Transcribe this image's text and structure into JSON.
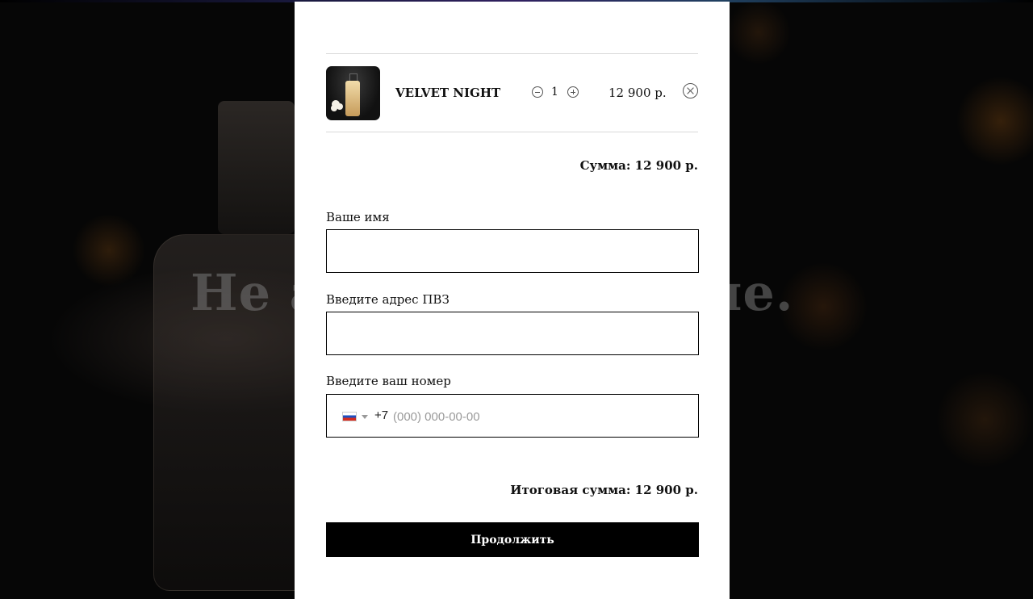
{
  "background": {
    "headline_visible_left": "Не а",
    "headline_visible_right": "ние."
  },
  "cart": {
    "items": [
      {
        "name": "VELVET NIGHT",
        "quantity": "1",
        "price": "12 900 р."
      }
    ],
    "subtotal": "Сумма: 12 900 р."
  },
  "form": {
    "name_label": "Ваше имя",
    "name_value": "",
    "address_label": "Введите адрес ПВЗ",
    "address_value": "",
    "phone_label": "Введите ваш номер",
    "phone_country_icon": "russia-flag-icon",
    "phone_code": "+7",
    "phone_placeholder": "(000) 000-00-00"
  },
  "total": "Итоговая сумма: 12 900 р.",
  "continue_label": "Продолжить"
}
